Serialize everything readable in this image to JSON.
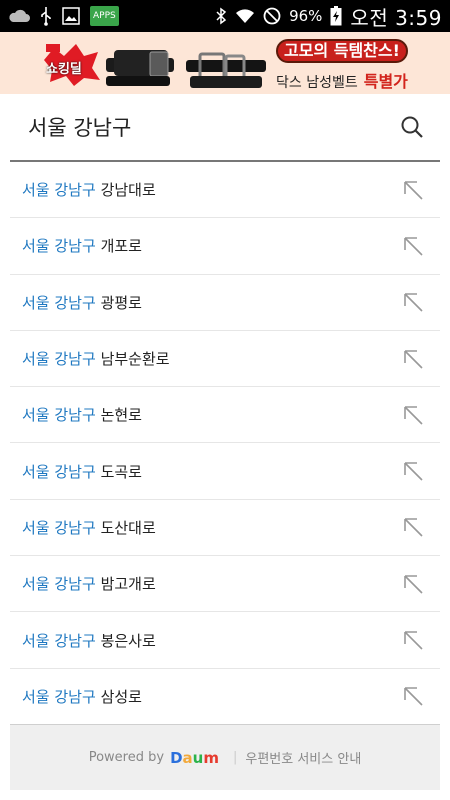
{
  "status_bar": {
    "battery": "96%",
    "time": "오전 3:59",
    "apps_label": "APPS"
  },
  "ad": {
    "logo_text": "쇼킹딜",
    "headline": "고모의 득템찬스!",
    "sub_text": "닥스 남성벨트",
    "sub_accent": "특별가"
  },
  "search": {
    "query": "서울 강남구"
  },
  "results": [
    {
      "highlight": "서울 강남구",
      "rest": "강남대로"
    },
    {
      "highlight": "서울 강남구",
      "rest": "개포로"
    },
    {
      "highlight": "서울 강남구",
      "rest": "광평로"
    },
    {
      "highlight": "서울 강남구",
      "rest": "남부순환로"
    },
    {
      "highlight": "서울 강남구",
      "rest": "논현로"
    },
    {
      "highlight": "서울 강남구",
      "rest": "도곡로"
    },
    {
      "highlight": "서울 강남구",
      "rest": "도산대로"
    },
    {
      "highlight": "서울 강남구",
      "rest": "밤고개로"
    },
    {
      "highlight": "서울 강남구",
      "rest": "봉은사로"
    },
    {
      "highlight": "서울 강남구",
      "rest": "삼성로"
    }
  ],
  "footer": {
    "powered_by": "Powered by",
    "brand": "Daum",
    "service_link": "우편번호 서비스 안내"
  },
  "colors": {
    "highlight": "#1f78c1",
    "ad_bg": "#fde6d7",
    "footer_bg": "#efefef"
  }
}
